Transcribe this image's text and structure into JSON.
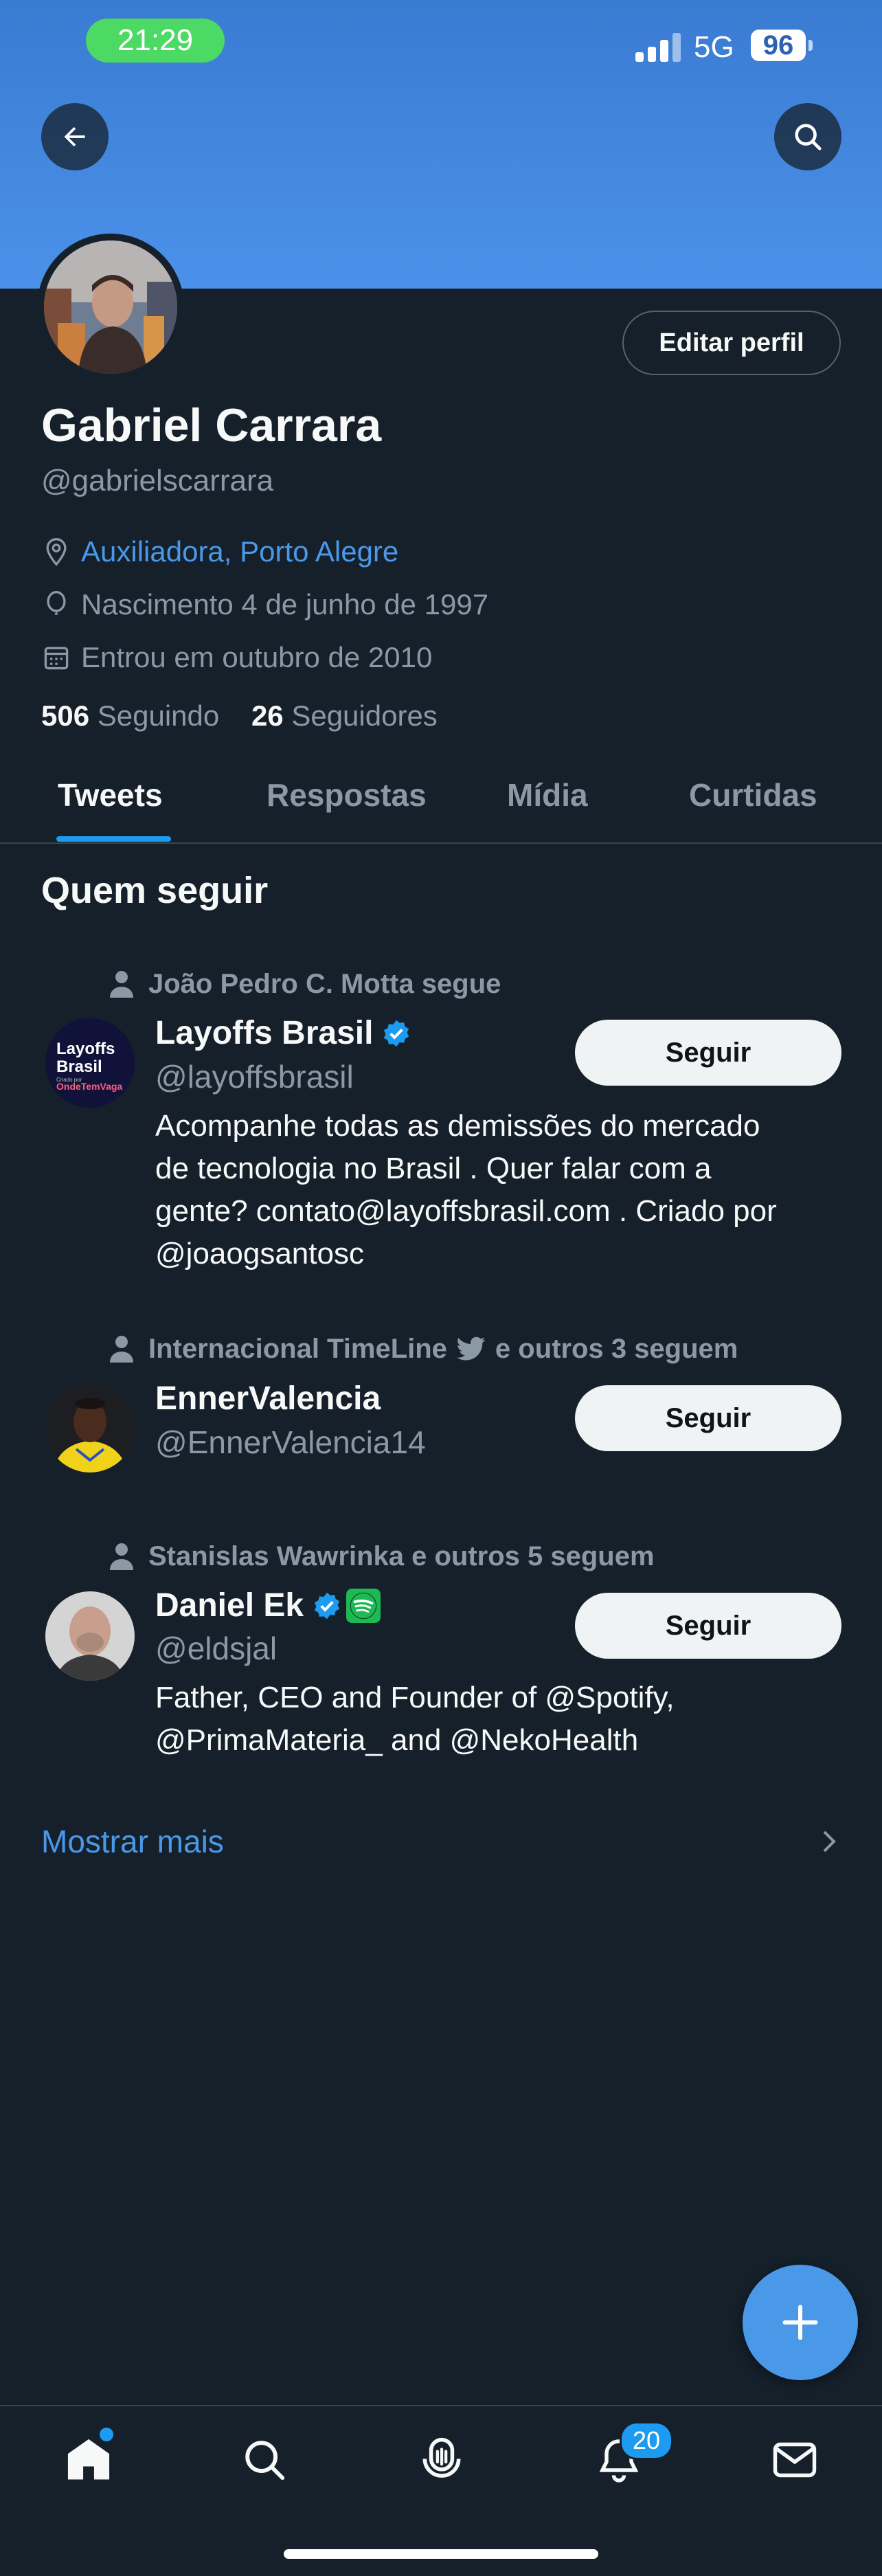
{
  "status_bar": {
    "time": "21:29",
    "network": "5G",
    "battery": "96"
  },
  "profile": {
    "name": "Gabriel Carrara",
    "handle": "@gabrielscarrara",
    "edit_label": "Editar perfil",
    "location": "Auxiliadora, Porto Alegre",
    "birth": "Nascimento 4 de junho de 1997",
    "joined": "Entrou em outubro de 2010",
    "following_count": "506",
    "following_label": "Seguindo",
    "followers_count": "26",
    "followers_label": "Seguidores"
  },
  "tabs": [
    {
      "label": "Tweets",
      "active": true
    },
    {
      "label": "Respostas",
      "active": false
    },
    {
      "label": "Mídia",
      "active": false
    },
    {
      "label": "Curtidas",
      "active": false
    }
  ],
  "who_to_follow": {
    "title": "Quem seguir",
    "button_label": "Seguir",
    "accounts": [
      {
        "context": "João Pedro C. Motta segue",
        "name": "Layoffs Brasil",
        "handle": "@layoffsbrasil",
        "verified": true,
        "avatar_text": [
          "Layoffs",
          "Brasil",
          "Criado por",
          "OndeTemVaga"
        ],
        "bio": [
          "Acompanhe todas as demissões do mercado",
          "de tecnologia no Brasil . Quer falar com a",
          "gente? contato@layoffsbrasil.com . Criado por",
          "@joaogsantosc"
        ]
      },
      {
        "context_a": "Internacional TimeLine",
        "context_b": "e outros 3 seguem",
        "name": "EnnerValencia",
        "handle": "@EnnerValencia14",
        "verified": false
      },
      {
        "context": "Stanislas Wawrinka e outros 5 seguem",
        "name": "Daniel Ek",
        "handle": "@eldsjal",
        "verified": true,
        "bio": [
          "Father, CEO and Founder of @Spotify,",
          "@PrimaMateria_ and @NekoHealth"
        ]
      }
    ],
    "show_more": "Mostrar mais"
  },
  "bottom_nav": {
    "notifications_badge": "20"
  },
  "colors": {
    "background": "#15202b",
    "accent": "#1d9bf0",
    "banner": "#4b91ea",
    "muted": "#8b98a5"
  }
}
